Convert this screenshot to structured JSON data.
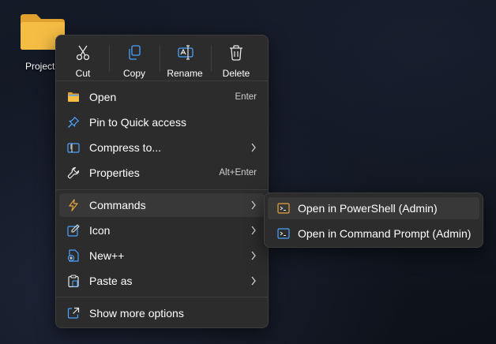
{
  "desktop": {
    "folder_label": "Project"
  },
  "toolbar": {
    "cut_label": "Cut",
    "copy_label": "Copy",
    "rename_label": "Rename",
    "delete_label": "Delete"
  },
  "menu": {
    "items": [
      {
        "label": "Open",
        "shortcut": "Enter",
        "icon": "folder-open-icon"
      },
      {
        "label": "Pin to Quick access",
        "icon": "pin-icon"
      },
      {
        "label": "Compress to...",
        "icon": "archive-icon",
        "submenu": true
      },
      {
        "label": "Properties",
        "shortcut": "Alt+Enter",
        "icon": "wrench-icon"
      },
      {
        "label": "Commands",
        "icon": "lightning-icon",
        "submenu": true,
        "highlighted": true
      },
      {
        "label": "Icon",
        "icon": "edit-icon",
        "submenu": true
      },
      {
        "label": "New++",
        "icon": "new-file-icon",
        "submenu": true
      },
      {
        "label": "Paste as",
        "icon": "clipboard-icon",
        "submenu": true
      },
      {
        "label": "Show more options",
        "icon": "share-icon"
      }
    ]
  },
  "submenu": {
    "items": [
      {
        "label": "Open in PowerShell (Admin)",
        "icon": "terminal-icon",
        "highlighted": true
      },
      {
        "label": "Open in Command Prompt (Admin)",
        "icon": "terminal-icon"
      }
    ]
  },
  "colors": {
    "menu_bg": "#2c2c2c",
    "highlight_bg": "#383838",
    "accent_blue": "#4aa3ff",
    "folder_yellow": "#f5b83d",
    "lightning_orange": "#e8a33a"
  }
}
